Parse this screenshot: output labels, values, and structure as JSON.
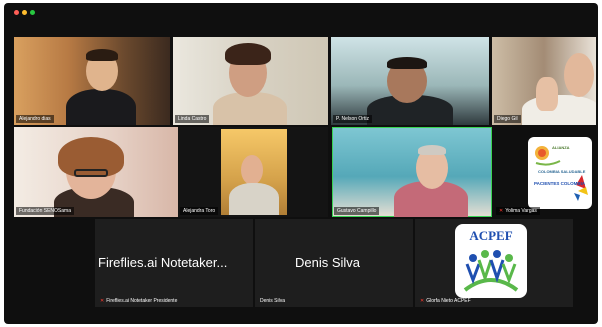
{
  "window": {
    "title": ""
  },
  "participants": [
    {
      "name": "Alejandro dias",
      "muted": false
    },
    {
      "name": "Linda Castro",
      "muted": false
    },
    {
      "name": "P. Nelson Ortiz",
      "muted": false
    },
    {
      "name": "Diego Gil",
      "muted": false
    },
    {
      "name": "Fundación SENOSama",
      "muted": false
    },
    {
      "name": "Alejandra Toro",
      "muted": false
    },
    {
      "name": "Gustavo Campillo",
      "muted": false,
      "speaking": true
    },
    {
      "name": "Yolima Vargas",
      "muted": true
    }
  ],
  "bottom_row": [
    {
      "display_name": "Fireflies.ai Notetaker...",
      "name": "Fireflies.ai Notetaker Presidente",
      "muted": true
    },
    {
      "display_name": "Denis Silva",
      "name": "Denis Silva",
      "muted": false
    },
    {
      "display_name": "",
      "name": "Glorfa Nieto ACPEF",
      "muted": true,
      "logo_text": "ACPEF"
    }
  ],
  "logos": {
    "yolima": {
      "line1": "ALIANZA",
      "line2": "COLOMBIA SALUDABLE",
      "line3": "PACIENTES COLOMBIA"
    }
  },
  "mic_icon": "microphone-muted-icon",
  "colors": {
    "speaking_border": "#39d353",
    "muted_mic": "#ff3b30",
    "acpef_blue": "#1f4fb0",
    "acpef_green": "#59b84a"
  }
}
